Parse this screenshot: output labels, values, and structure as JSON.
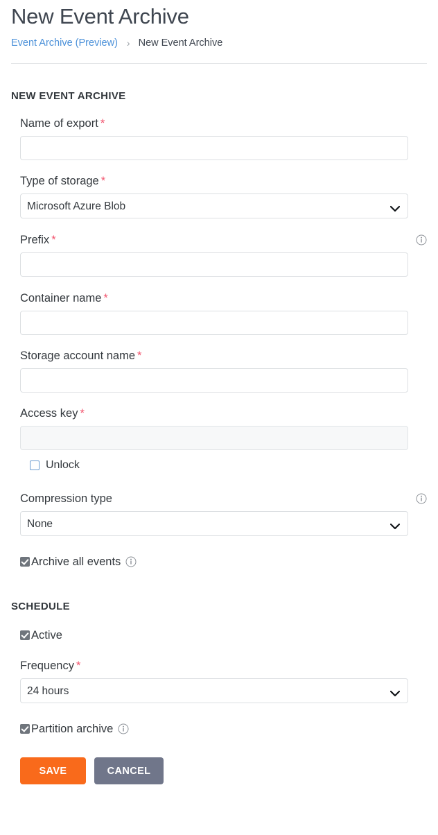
{
  "header": {
    "title": "New Event Archive",
    "breadcrumb": {
      "parent": "Event Archive (Preview)",
      "separator": "›",
      "current": "New Event Archive"
    }
  },
  "form": {
    "section_title": "NEW EVENT ARCHIVE",
    "required_marker": "*",
    "fields": {
      "name_of_export": {
        "label": "Name of export",
        "value": "",
        "placeholder": ""
      },
      "type_of_storage": {
        "label": "Type of storage",
        "value": "Microsoft Azure Blob",
        "options": [
          "Microsoft Azure Blob"
        ]
      },
      "prefix": {
        "label": "Prefix",
        "value": "",
        "placeholder": "",
        "info_icon": "info-circle-icon"
      },
      "container_name": {
        "label": "Container name",
        "value": "",
        "placeholder": ""
      },
      "storage_account_name": {
        "label": "Storage account name",
        "value": "",
        "placeholder": ""
      },
      "access_key": {
        "label": "Access key",
        "value": "",
        "placeholder": "",
        "disabled": true,
        "unlock_label": "Unlock",
        "unlock_checked": false
      },
      "compression_type": {
        "label": "Compression type",
        "value": "None",
        "options": [
          "None"
        ],
        "info_icon": "info-circle-icon"
      },
      "archive_all_events": {
        "label": "Archive all events",
        "checked": true,
        "info_icon": "info-circle-icon"
      }
    }
  },
  "schedule": {
    "section_title": "SCHEDULE",
    "active": {
      "label": "Active",
      "checked": true
    },
    "frequency": {
      "label": "Frequency",
      "value": "24 hours",
      "options": [
        "24 hours"
      ]
    },
    "partition_archive": {
      "label": "Partition archive",
      "checked": true,
      "info_icon": "info-circle-icon"
    }
  },
  "actions": {
    "save_label": "SAVE",
    "cancel_label": "CANCEL"
  },
  "colors": {
    "save_button": "#f96a1b",
    "cancel_button": "#70768a",
    "required_asterisk": "#f2566f",
    "breadcrumb_link": "#4a90d9",
    "checkbox_checked": "#6f757c"
  }
}
